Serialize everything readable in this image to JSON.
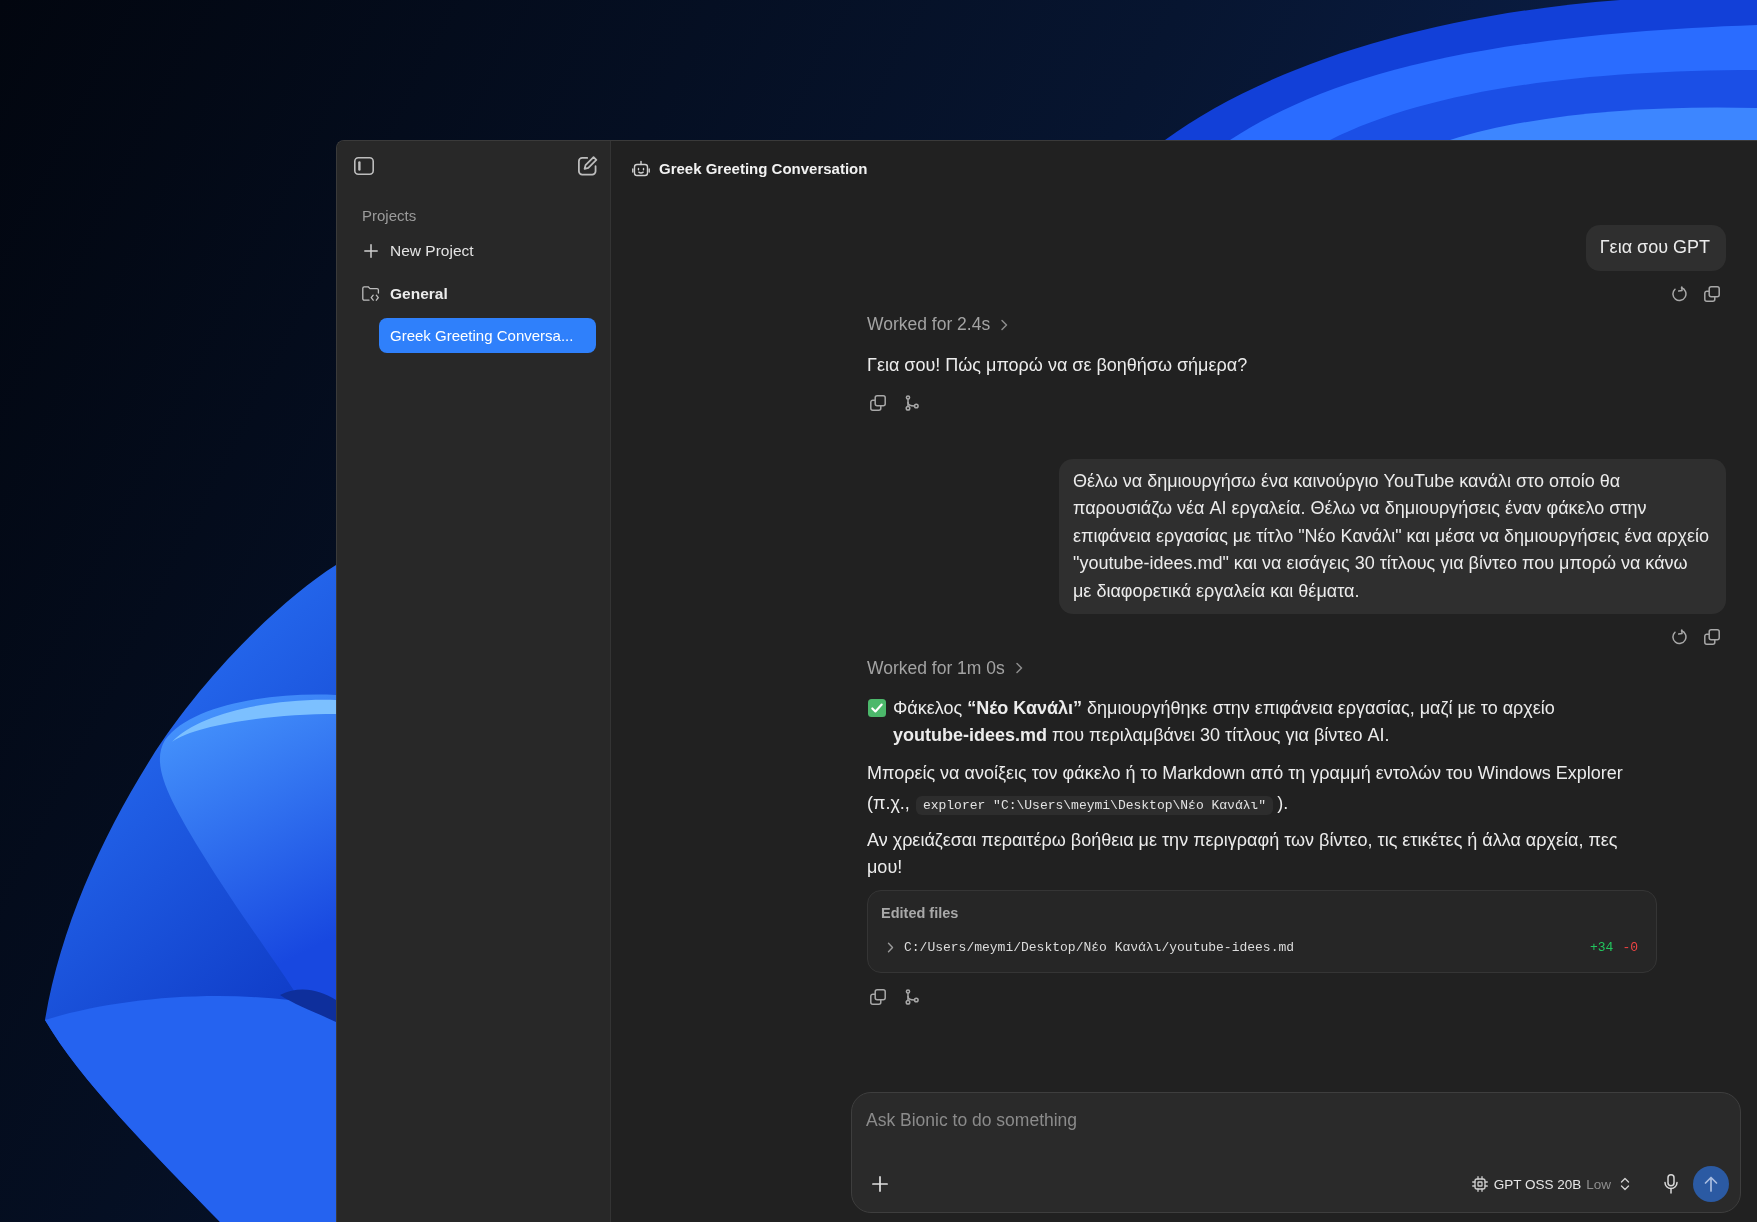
{
  "window": {
    "title": "Greek Greeting Conversation"
  },
  "sidebar": {
    "section_title": "Projects",
    "new_project_label": "New Project",
    "projects": [
      {
        "name": "General",
        "chats": [
          {
            "title": "Greek Greeting Conversa...",
            "selected": true
          }
        ]
      }
    ]
  },
  "messages": [
    {
      "kind": "user",
      "text": "Γεια σου GPT"
    },
    {
      "kind": "assistant",
      "worked": {
        "label": "Worked for 2.4s",
        "expanded": false
      },
      "paragraphs": [
        {
          "kind": "text",
          "text": "Γεια σου! Πώς μπορώ να σε βοηθήσω σήμερα?"
        }
      ]
    },
    {
      "kind": "user",
      "text": "Θέλω να δημιουργήσω ένα καινούργιο YouTube κανάλι στο οποίο θα παρουσιάζω νέα AI εργαλεία. Θέλω να δημιουργήσεις έναν φάκελο στην επιφάνεια εργασίας με τίτλο \"Νέο Κανάλι\" και μέσα να δημιουργήσεις ένα αρχείο \"youtube-idees.md\" και να εισάγεις 30 τίτλους για βίντεο που μπορώ να κάνω με διαφορετικά εργαλεία και θέματα."
    },
    {
      "kind": "assistant",
      "worked": {
        "label": "Worked for 1m 0s",
        "expanded": false
      },
      "paragraphs": [
        {
          "kind": "success",
          "text": "Φάκελος **“Νέο Κανάλι”** δημιουργήθηκε στην επιφάνεια εργασίας, μαζί με το αρχείο **youtube-idees.md** που περιλαμβάνει 30 τίτλους για βίντεο AI."
        },
        {
          "kind": "code",
          "before": "Μπορείς να ανοίξεις τον φάκελο ή το Markdown από τη γραμμή εντολών του Windows Explorer (π.χ.,",
          "code": "explorer \"C:\\Users\\meymi\\Desktop\\Νέο Κανάλι\"",
          "after": ")."
        },
        {
          "kind": "text",
          "text": "Αν χρειάζεσαι περαιτέρω βοήθεια με την περιγραφή των βίντεο, τις ετικέτες ή άλλα αρχεία, πες μου!"
        }
      ],
      "edited_files": {
        "title": "Edited files",
        "files": [
          {
            "path": "C:/Users/meymi/Desktop/Νέο Κανάλι/youtube-idees.md",
            "added": "+34",
            "removed": "-0",
            "expanded": false
          }
        ]
      }
    }
  ],
  "composer": {
    "placeholder": "Ask Bionic to do something",
    "model": "GPT OSS 20B",
    "effort": "Low",
    "send_disabled": true
  }
}
